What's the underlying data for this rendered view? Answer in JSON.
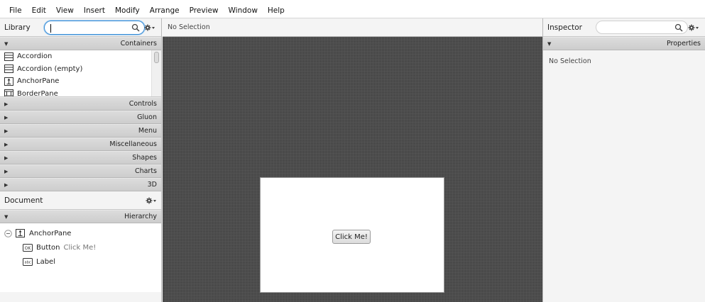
{
  "menubar": {
    "items": [
      "File",
      "Edit",
      "View",
      "Insert",
      "Modify",
      "Arrange",
      "Preview",
      "Window",
      "Help"
    ]
  },
  "library": {
    "title": "Library",
    "search": {
      "value": "",
      "placeholder": ""
    },
    "sections": {
      "containers": "Containers",
      "controls": "Controls",
      "gluon": "Gluon",
      "menu": "Menu",
      "miscellaneous": "Miscellaneous",
      "shapes": "Shapes",
      "charts": "Charts",
      "threed": "3D"
    },
    "items": [
      {
        "label": "Accordion",
        "icon": "accordion-icon"
      },
      {
        "label": "Accordion  (empty)",
        "icon": "accordion-icon"
      },
      {
        "label": "AnchorPane",
        "icon": "anchorpane-icon"
      },
      {
        "label": "BorderPane",
        "icon": "borderpane-icon"
      }
    ]
  },
  "document": {
    "title": "Document",
    "hierarchy_label": "Hierarchy",
    "tree": {
      "root": {
        "label": "AnchorPane",
        "icon": "anchorpane-icon"
      },
      "children": [
        {
          "label": "Button",
          "detail": "Click Me!",
          "icon": "button-ok-icon"
        },
        {
          "label": "Label",
          "detail": "",
          "icon": "label-abc-icon"
        }
      ]
    }
  },
  "center": {
    "selection_text": "No Selection",
    "button_label": "Click Me!"
  },
  "inspector": {
    "title": "Inspector",
    "search": {
      "value": "",
      "placeholder": ""
    },
    "section_label": "Properties",
    "body_text": "No Selection"
  },
  "colors": {
    "canvas": "#4a4a4a",
    "focus_ring": "#3c8ed6",
    "section_bar": "#d4d4d4"
  }
}
